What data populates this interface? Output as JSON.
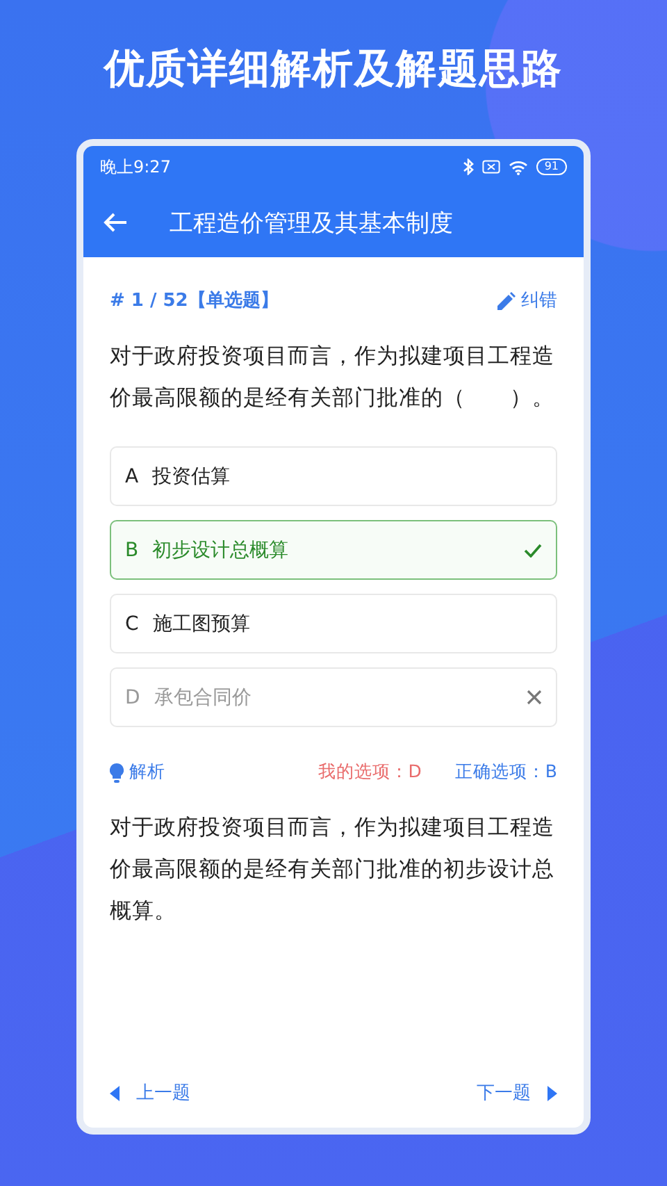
{
  "headline": "优质详细解析及解题思路",
  "status_bar": {
    "time": "晚上9:27",
    "battery": "91"
  },
  "app_bar": {
    "title": "工程造价管理及其基本制度"
  },
  "question": {
    "number": "# 1 / 52",
    "type": "【单选题】",
    "report": "纠错",
    "text": "对于政府投资项目而言，作为拟建项目工程造价最高限额的是经有关部门批准的（　　）。"
  },
  "options": [
    {
      "letter": "A",
      "text": "投资估算",
      "kind": "normal"
    },
    {
      "letter": "B",
      "text": "初步设计总概算",
      "kind": "correct"
    },
    {
      "letter": "C",
      "text": "施工图预算",
      "kind": "normal"
    },
    {
      "letter": "D",
      "text": "承包合同价",
      "kind": "wrong"
    }
  ],
  "analysis": {
    "label": "解析",
    "my_answer": "我的选项：D",
    "correct_answer": "正确选项：B",
    "text": "对于政府投资项目而言，作为拟建项目工程造价最高限额的是经有关部门批准的初步设计总概算。"
  },
  "nav": {
    "prev": "上一题",
    "next": "下一题"
  }
}
